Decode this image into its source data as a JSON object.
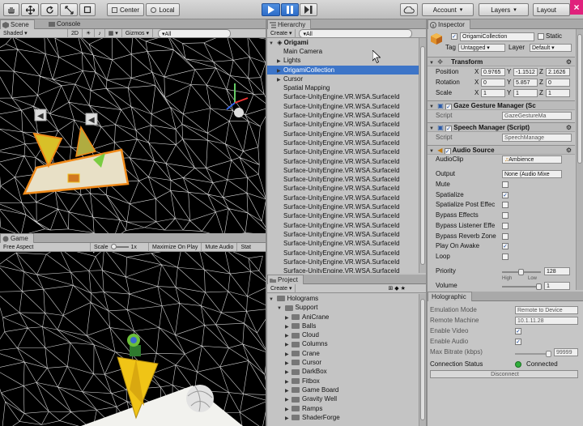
{
  "toolbar": {
    "pivot": "Center",
    "space": "Local",
    "account": "Account",
    "layers": "Layers",
    "layout": "Layout",
    "close_glyph": "×"
  },
  "scene": {
    "tab_scene": "Scene",
    "tab_console": "Console",
    "shading": "Shaded",
    "mode_2d": "2D",
    "gizmos": "Gizmos",
    "search": "▾All"
  },
  "game": {
    "tab": "Game",
    "aspect": "Free Aspect",
    "scale_label": "Scale",
    "scale_value": "1x",
    "maximize": "Maximize On Play",
    "mute": "Mute Audio",
    "stats": "Stat"
  },
  "hierarchy": {
    "tab": "Hierarchy",
    "create": "Create",
    "search": "▾All",
    "scene_name": "Origami",
    "items": [
      {
        "label": "Main Camera",
        "arrow": "",
        "selected": false
      },
      {
        "label": "Lights",
        "arrow": "▶",
        "selected": false
      },
      {
        "label": "OrigamiCollection",
        "arrow": "▶",
        "selected": true
      },
      {
        "label": "Cursor",
        "arrow": "▶",
        "selected": false
      },
      {
        "label": "Spatial Mapping",
        "arrow": "",
        "selected": false
      },
      {
        "label": "Surface-UnityEngine.VR.WSA.SurfaceId",
        "arrow": "",
        "selected": false
      },
      {
        "label": "Surface-UnityEngine.VR.WSA.SurfaceId",
        "arrow": "",
        "selected": false
      },
      {
        "label": "Surface-UnityEngine.VR.WSA.SurfaceId",
        "arrow": "",
        "selected": false
      },
      {
        "label": "Surface-UnityEngine.VR.WSA.SurfaceId",
        "arrow": "",
        "selected": false
      },
      {
        "label": "Surface-UnityEngine.VR.WSA.SurfaceId",
        "arrow": "",
        "selected": false
      },
      {
        "label": "Surface-UnityEngine.VR.WSA.SurfaceId",
        "arrow": "",
        "selected": false
      },
      {
        "label": "Surface-UnityEngine.VR.WSA.SurfaceId",
        "arrow": "",
        "selected": false
      },
      {
        "label": "Surface-UnityEngine.VR.WSA.SurfaceId",
        "arrow": "",
        "selected": false
      },
      {
        "label": "Surface-UnityEngine.VR.WSA.SurfaceId",
        "arrow": "",
        "selected": false
      },
      {
        "label": "Surface-UnityEngine.VR.WSA.SurfaceId",
        "arrow": "",
        "selected": false
      },
      {
        "label": "Surface-UnityEngine.VR.WSA.SurfaceId",
        "arrow": "",
        "selected": false
      },
      {
        "label": "Surface-UnityEngine.VR.WSA.SurfaceId",
        "arrow": "",
        "selected": false
      },
      {
        "label": "Surface-UnityEngine.VR.WSA.SurfaceId",
        "arrow": "",
        "selected": false
      },
      {
        "label": "Surface-UnityEngine.VR.WSA.SurfaceId",
        "arrow": "",
        "selected": false
      },
      {
        "label": "Surface-UnityEngine.VR.WSA.SurfaceId",
        "arrow": "",
        "selected": false
      },
      {
        "label": "Surface-UnityEngine.VR.WSA.SurfaceId",
        "arrow": "",
        "selected": false
      },
      {
        "label": "Surface-UnityEngine.VR.WSA.SurfaceId",
        "arrow": "",
        "selected": false
      },
      {
        "label": "Surface-UnityEngine.VR.WSA.SurfaceId",
        "arrow": "",
        "selected": false
      },
      {
        "label": "Surface-UnityEngine.VR.WSA.SurfaceId",
        "arrow": "",
        "selected": false
      },
      {
        "label": "Surface-UnityEngine.VR.WSA.SurfaceId",
        "arrow": "",
        "selected": false
      },
      {
        "label": "Surface-UnityEngine.VR.WSA.SurfaceId",
        "arrow": "",
        "selected": false
      },
      {
        "label": "Surface-UnityEngine.VR.WSA.SurfaceId",
        "arrow": "",
        "selected": false
      },
      {
        "label": "Surface-UnityEngine.VR.WSA.SurfaceId",
        "arrow": "",
        "selected": false
      }
    ]
  },
  "project": {
    "tab": "Project",
    "create": "Create",
    "root": "Holograms",
    "support": "Support",
    "folders": [
      "AniCrane",
      "Balls",
      "Cloud",
      "Columns",
      "Crane",
      "Cursor",
      "DarkBox",
      "Fitbox",
      "Game Board",
      "Gravity Well",
      "Ramps",
      "ShaderForge"
    ]
  },
  "inspector": {
    "tab": "Inspector",
    "object_name": "OrigamiCollection",
    "static_label": "Static",
    "tag_label": "Tag",
    "tag_value": "Untagged",
    "layer_label": "Layer",
    "layer_value": "Default",
    "transform": {
      "title": "Transform",
      "position_label": "Position",
      "rotation_label": "Rotation",
      "scale_label": "Scale",
      "position": [
        "0.9765",
        "-1.1512",
        "2.1626"
      ],
      "rotation": [
        "0",
        "5.857",
        "0"
      ],
      "scale": [
        "1",
        "1",
        "1"
      ]
    },
    "gaze": {
      "title": "Gaze Gesture Manager (Sc",
      "script_label": "Script",
      "script_value": "GazeGestureMa"
    },
    "speech": {
      "title": "Speech Manager (Script)",
      "script_label": "Script",
      "script_value": "SpeechManage"
    },
    "audio": {
      "title": "Audio Source",
      "clip_label": "AudioClip",
      "clip_value": "Ambience",
      "output_label": "Output",
      "output_value": "None (Audio Mixe",
      "mute": "Mute",
      "spatialize": "Spatialize",
      "spatialize_post": "Spatialize Post Effec",
      "bypass_effects": "Bypass Effects",
      "bypass_listener": "Bypass Listener Effe",
      "bypass_reverb": "Bypass Reverb Zone",
      "play_on_awake": "Play On Awake",
      "loop": "Loop",
      "priority_label": "Priority",
      "priority_value": "128",
      "high": "High",
      "low": "Low",
      "volume_label": "Volume",
      "volume_value": "1"
    }
  },
  "holographic": {
    "tab": "Holographic",
    "emulation_label": "Emulation Mode",
    "emulation_value": "Remote to Device",
    "remote_label": "Remote Machine",
    "remote_value": "10.1.11.28",
    "video_label": "Enable Video",
    "audio_label": "Enable Audio",
    "bitrate_label": "Max Bitrate (kbps)",
    "bitrate_value": "99999",
    "status_label": "Connection Status",
    "status_value": "Connected",
    "disconnect": "Disconnect"
  },
  "colors": {
    "selection": "#3d75c8",
    "play_blue": "#2d6cc8",
    "connected": "#2fae3a",
    "close_pink": "#e0217c"
  }
}
